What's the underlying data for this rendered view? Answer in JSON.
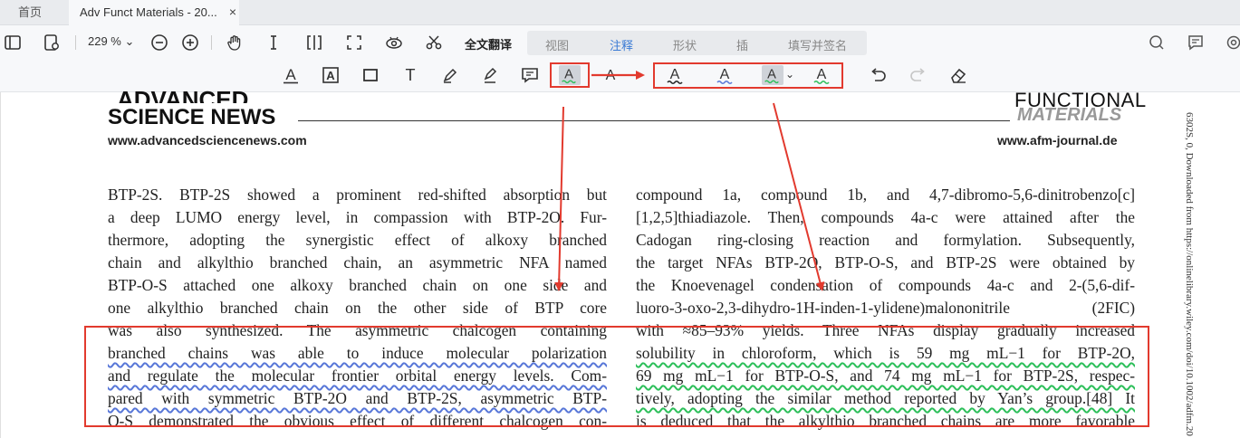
{
  "tabs": {
    "home": "首页",
    "document": "Adv Funct Materials - 20...",
    "close": "×"
  },
  "toolbar": {
    "zoom": "229 %",
    "full_translate": "全文翻译",
    "menu": [
      "视图",
      "注释",
      "形状",
      "插",
      "填写并签名"
    ]
  },
  "annotation_tools": {
    "glyph_letter": "A",
    "glyph_text": "T",
    "glyph_area": "A",
    "dropdown": "⌄"
  },
  "document": {
    "header_left_top": "ADVANCED",
    "header_left": "SCIENCE NEWS",
    "header_right_top": "FUNCTIONAL",
    "header_right": "MATERIALS",
    "url_left": "www.advancedsciencenews.com",
    "url_right": "www.afm-journal.de",
    "side_text": "6302S, 0, Downloaded from https://onlinelibrary.wiley.com/doi/10.1002/adfm.20",
    "col1": [
      "BTP-2S. BTP-2S showed a prominent red-shifted absorption but",
      "a deep LUMO energy level, in compassion with BTP-2O. Fur-",
      "thermore, adopting the synergistic effect of alkoxy branched",
      "chain and alkylthio branched chain, an asymmetric NFA named",
      "BTP-O-S attached one alkoxy branched chain on one side and",
      "one alkylthio branched chain on the other side of BTP core",
      "was also synthesized. The asymmetric chalcogen containing",
      "branched chains was able to induce molecular polarization",
      "and regulate the molecular frontier orbital energy levels. Com-",
      "pared with symmetric BTP-2O and BTP-2S, asymmetric BTP-",
      "O-S demonstrated the obvious effect of different chalcogen con-"
    ],
    "col2": [
      "compound 1a, compound 1b, and 4,7-dibromo-5,6-dinitrobenzo[c]",
      "[1,2,5]thiadiazole. Then, compounds 4a-c were attained after the",
      "Cadogan ring-closing reaction and formylation. Subsequently,",
      "the target NFAs BTP-2O, BTP-O-S, and BTP-2S were obtained by",
      "the Knoevenagel condensation of compounds 4a-c and 2-(5,6-dif-",
      "luoro-3-oxo-2,3-dihydro-1H-inden-1-ylidene)malononitrile (2FIC)",
      "with ≈85–93% yields. Three NFAs display gradually increased",
      "solubility in chloroform, which is 59 mg mL−1 for BTP-2O,",
      "69 mg mL−1 for BTP-O-S, and 74 mg mL−1 for BTP-2S, respec-",
      "tively, adopting the similar method reported by Yan’s group.[48] It",
      "is deduced that the alkylthio branched chains are more favorable"
    ]
  },
  "colors": {
    "accent": "#3a7bd5",
    "annotation_red": "#e23a2e",
    "wave_blue": "#5877d8",
    "wave_green": "#2dbf5a"
  }
}
